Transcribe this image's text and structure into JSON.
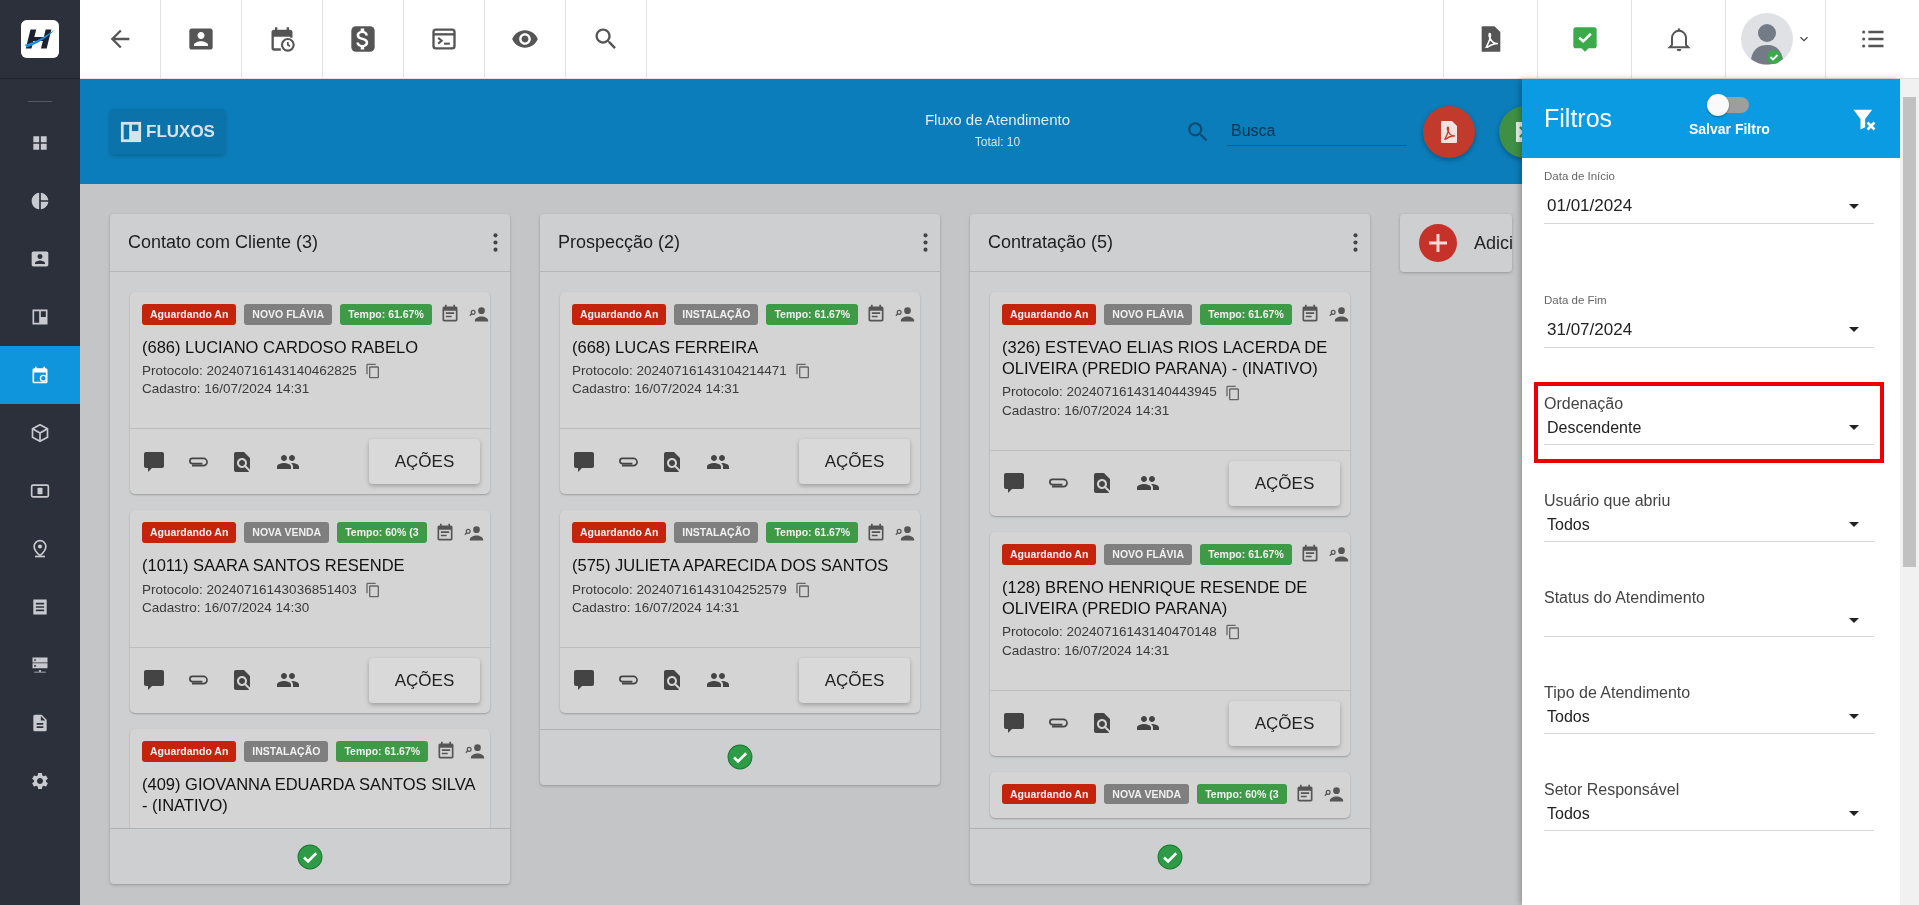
{
  "sidebar": {
    "items": [
      {
        "selected": false
      },
      {
        "selected": false
      },
      {
        "selected": false
      },
      {
        "selected": false
      },
      {
        "selected": true
      },
      {
        "selected": false
      },
      {
        "selected": false
      },
      {
        "selected": false
      },
      {
        "selected": false
      },
      {
        "selected": false
      },
      {
        "selected": false
      },
      {
        "selected": false
      }
    ]
  },
  "header": {
    "button": "FLUXOS",
    "title": "Fluxo de Atendimento",
    "total": "Total: 10",
    "search": {
      "placeholder": "Busca"
    }
  },
  "columns": [
    {
      "title": "Contato com Cliente",
      "count": "(3)",
      "cards": [
        {
          "tags": [
            {
              "text": "Aguardando An",
              "color": "#c4240c"
            },
            {
              "text": "NOVO FLÁVIA",
              "color": "#7f7f7f"
            },
            {
              "text": "Tempo: 61.67%",
              "color": "#3f9a48"
            }
          ],
          "title": "(686) LUCIANO CARDOSO RABELO",
          "protocol": "Protocolo: 20240716143140462825",
          "created": "Cadastro: 16/07/2024 14:31",
          "action": "AÇÕES"
        },
        {
          "tags": [
            {
              "text": "Aguardando An",
              "color": "#c4240c"
            },
            {
              "text": "NOVA VENDA",
              "color": "#7f7f7f"
            },
            {
              "text": "Tempo: 60% (3",
              "color": "#3f9a48"
            }
          ],
          "title": "(1011) SAARA SANTOS RESENDE",
          "protocol": "Protocolo: 20240716143036851403",
          "created": "Cadastro: 16/07/2024 14:30",
          "action": "AÇÕES"
        },
        {
          "tags": [
            {
              "text": "Aguardando An",
              "color": "#c4240c"
            },
            {
              "text": "INSTALAÇÃO",
              "color": "#7f7f7f"
            },
            {
              "text": "Tempo: 61.67%",
              "color": "#3f9a48"
            }
          ],
          "title": "(409) GIOVANNA EDUARDA SANTOS SILVA - (INATIVO)"
        }
      ]
    },
    {
      "title": "Prospecção",
      "count": "(2)",
      "cards": [
        {
          "tags": [
            {
              "text": "Aguardando An",
              "color": "#c4240c"
            },
            {
              "text": "INSTALAÇÃO",
              "color": "#7f7f7f"
            },
            {
              "text": "Tempo: 61.67%",
              "color": "#3f9a48"
            }
          ],
          "title": "(668) LUCAS FERREIRA",
          "protocol": "Protocolo: 20240716143104214471",
          "created": "Cadastro: 16/07/2024 14:31",
          "action": "AÇÕES"
        },
        {
          "tags": [
            {
              "text": "Aguardando An",
              "color": "#c4240c"
            },
            {
              "text": "INSTALAÇÃO",
              "color": "#7f7f7f"
            },
            {
              "text": "Tempo: 61.67%",
              "color": "#3f9a48"
            }
          ],
          "title": "(575) JULIETA APARECIDA DOS SANTOS",
          "protocol": "Protocolo: 20240716143104252579",
          "created": "Cadastro: 16/07/2024 14:31",
          "action": "AÇÕES"
        }
      ]
    },
    {
      "title": "Contratação",
      "count": "(5)",
      "cards": [
        {
          "tags": [
            {
              "text": "Aguardando An",
              "color": "#c4240c"
            },
            {
              "text": "NOVO FLÁVIA",
              "color": "#7f7f7f"
            },
            {
              "text": "Tempo: 61.67%",
              "color": "#3f9a48"
            }
          ],
          "title": "(326) ESTEVAO ELIAS RIOS LACERDA DE OLIVEIRA (PREDIO PARANA) - (INATIVO)",
          "protocol": "Protocolo: 20240716143140443945",
          "created": "Cadastro: 16/07/2024 14:31",
          "action": "AÇÕES"
        },
        {
          "tags": [
            {
              "text": "Aguardando An",
              "color": "#c4240c"
            },
            {
              "text": "NOVO FLÁVIA",
              "color": "#7f7f7f"
            },
            {
              "text": "Tempo: 61.67%",
              "color": "#3f9a48"
            }
          ],
          "title": "(128) BRENO HENRIQUE RESENDE DE OLIVEIRA (PREDIO PARANA)",
          "protocol": "Protocolo: 20240716143140470148",
          "created": "Cadastro: 16/07/2024 14:31",
          "action": "AÇÕES"
        },
        {
          "tags": [
            {
              "text": "Aguardando An",
              "color": "#c4240c"
            },
            {
              "text": "NOVA VENDA",
              "color": "#7f7f7f"
            },
            {
              "text": "Tempo: 60% (3",
              "color": "#3f9a48"
            }
          ]
        }
      ]
    }
  ],
  "add_column": {
    "label": "Adici"
  },
  "filters": {
    "title": "Filtros",
    "save_toggle": {
      "label": "Salvar Filtro",
      "on": false
    },
    "fields": [
      {
        "kind": "date",
        "label": "Data de Início",
        "value": "01/01/2024",
        "highlighted": false
      },
      {
        "kind": "date",
        "label": "Data de Fim",
        "value": "31/07/2024",
        "highlighted": false
      },
      {
        "kind": "select",
        "label": "Ordenação",
        "value": "Descendente",
        "highlighted": true
      },
      {
        "kind": "select",
        "label": "Usuário que abriu",
        "value": "Todos",
        "highlighted": false
      },
      {
        "kind": "select",
        "label": "Status do Atendimento",
        "highlighted": false
      },
      {
        "kind": "select",
        "label": "Tipo de Atendimento",
        "value": "Todos",
        "highlighted": false
      },
      {
        "kind": "select",
        "label": "Setor Responsável",
        "value": "Todos",
        "highlighted": false
      }
    ]
  }
}
